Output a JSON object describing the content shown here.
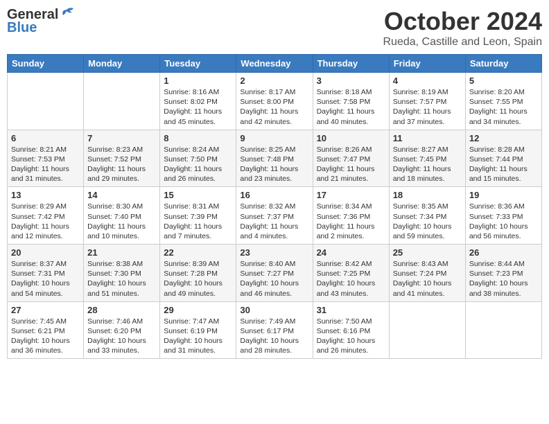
{
  "logo": {
    "general": "General",
    "blue": "Blue"
  },
  "title": "October 2024",
  "location": "Rueda, Castille and Leon, Spain",
  "days_header": [
    "Sunday",
    "Monday",
    "Tuesday",
    "Wednesday",
    "Thursday",
    "Friday",
    "Saturday"
  ],
  "weeks": [
    [
      {
        "num": "",
        "info": ""
      },
      {
        "num": "",
        "info": ""
      },
      {
        "num": "1",
        "info": "Sunrise: 8:16 AM\nSunset: 8:02 PM\nDaylight: 11 hours and 45 minutes."
      },
      {
        "num": "2",
        "info": "Sunrise: 8:17 AM\nSunset: 8:00 PM\nDaylight: 11 hours and 42 minutes."
      },
      {
        "num": "3",
        "info": "Sunrise: 8:18 AM\nSunset: 7:58 PM\nDaylight: 11 hours and 40 minutes."
      },
      {
        "num": "4",
        "info": "Sunrise: 8:19 AM\nSunset: 7:57 PM\nDaylight: 11 hours and 37 minutes."
      },
      {
        "num": "5",
        "info": "Sunrise: 8:20 AM\nSunset: 7:55 PM\nDaylight: 11 hours and 34 minutes."
      }
    ],
    [
      {
        "num": "6",
        "info": "Sunrise: 8:21 AM\nSunset: 7:53 PM\nDaylight: 11 hours and 31 minutes."
      },
      {
        "num": "7",
        "info": "Sunrise: 8:23 AM\nSunset: 7:52 PM\nDaylight: 11 hours and 29 minutes."
      },
      {
        "num": "8",
        "info": "Sunrise: 8:24 AM\nSunset: 7:50 PM\nDaylight: 11 hours and 26 minutes."
      },
      {
        "num": "9",
        "info": "Sunrise: 8:25 AM\nSunset: 7:48 PM\nDaylight: 11 hours and 23 minutes."
      },
      {
        "num": "10",
        "info": "Sunrise: 8:26 AM\nSunset: 7:47 PM\nDaylight: 11 hours and 21 minutes."
      },
      {
        "num": "11",
        "info": "Sunrise: 8:27 AM\nSunset: 7:45 PM\nDaylight: 11 hours and 18 minutes."
      },
      {
        "num": "12",
        "info": "Sunrise: 8:28 AM\nSunset: 7:44 PM\nDaylight: 11 hours and 15 minutes."
      }
    ],
    [
      {
        "num": "13",
        "info": "Sunrise: 8:29 AM\nSunset: 7:42 PM\nDaylight: 11 hours and 12 minutes."
      },
      {
        "num": "14",
        "info": "Sunrise: 8:30 AM\nSunset: 7:40 PM\nDaylight: 11 hours and 10 minutes."
      },
      {
        "num": "15",
        "info": "Sunrise: 8:31 AM\nSunset: 7:39 PM\nDaylight: 11 hours and 7 minutes."
      },
      {
        "num": "16",
        "info": "Sunrise: 8:32 AM\nSunset: 7:37 PM\nDaylight: 11 hours and 4 minutes."
      },
      {
        "num": "17",
        "info": "Sunrise: 8:34 AM\nSunset: 7:36 PM\nDaylight: 11 hours and 2 minutes."
      },
      {
        "num": "18",
        "info": "Sunrise: 8:35 AM\nSunset: 7:34 PM\nDaylight: 10 hours and 59 minutes."
      },
      {
        "num": "19",
        "info": "Sunrise: 8:36 AM\nSunset: 7:33 PM\nDaylight: 10 hours and 56 minutes."
      }
    ],
    [
      {
        "num": "20",
        "info": "Sunrise: 8:37 AM\nSunset: 7:31 PM\nDaylight: 10 hours and 54 minutes."
      },
      {
        "num": "21",
        "info": "Sunrise: 8:38 AM\nSunset: 7:30 PM\nDaylight: 10 hours and 51 minutes."
      },
      {
        "num": "22",
        "info": "Sunrise: 8:39 AM\nSunset: 7:28 PM\nDaylight: 10 hours and 49 minutes."
      },
      {
        "num": "23",
        "info": "Sunrise: 8:40 AM\nSunset: 7:27 PM\nDaylight: 10 hours and 46 minutes."
      },
      {
        "num": "24",
        "info": "Sunrise: 8:42 AM\nSunset: 7:25 PM\nDaylight: 10 hours and 43 minutes."
      },
      {
        "num": "25",
        "info": "Sunrise: 8:43 AM\nSunset: 7:24 PM\nDaylight: 10 hours and 41 minutes."
      },
      {
        "num": "26",
        "info": "Sunrise: 8:44 AM\nSunset: 7:23 PM\nDaylight: 10 hours and 38 minutes."
      }
    ],
    [
      {
        "num": "27",
        "info": "Sunrise: 7:45 AM\nSunset: 6:21 PM\nDaylight: 10 hours and 36 minutes."
      },
      {
        "num": "28",
        "info": "Sunrise: 7:46 AM\nSunset: 6:20 PM\nDaylight: 10 hours and 33 minutes."
      },
      {
        "num": "29",
        "info": "Sunrise: 7:47 AM\nSunset: 6:19 PM\nDaylight: 10 hours and 31 minutes."
      },
      {
        "num": "30",
        "info": "Sunrise: 7:49 AM\nSunset: 6:17 PM\nDaylight: 10 hours and 28 minutes."
      },
      {
        "num": "31",
        "info": "Sunrise: 7:50 AM\nSunset: 6:16 PM\nDaylight: 10 hours and 26 minutes."
      },
      {
        "num": "",
        "info": ""
      },
      {
        "num": "",
        "info": ""
      }
    ]
  ]
}
